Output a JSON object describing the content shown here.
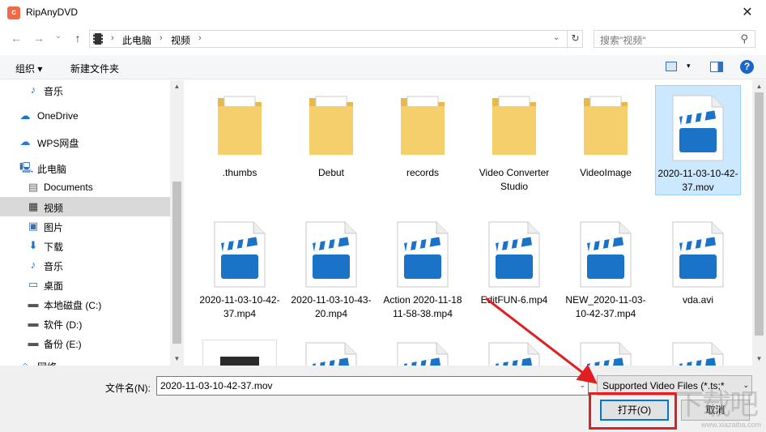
{
  "window": {
    "title": "RipAnyDVD",
    "app_icon_letter": "c",
    "close_glyph": "✕"
  },
  "nav": {
    "back": "←",
    "forward": "→",
    "dropdown": "⌄",
    "up": "↑"
  },
  "address": {
    "crumbs": [
      "此电脑",
      "视频"
    ],
    "sep": "›",
    "dropdown": "⌄",
    "refresh": "↻"
  },
  "search": {
    "placeholder": "搜索\"视频\"",
    "icon": "⚲"
  },
  "toolbar": {
    "organize": "组织 ▾",
    "new_folder": "新建文件夹",
    "view_dropdown": "▾",
    "help": "?"
  },
  "sidebar": {
    "items": [
      {
        "label": "音乐",
        "icon": "music-icon",
        "glyph": "♪",
        "color": "#1a73c7"
      },
      {
        "label": "OneDrive",
        "icon": "cloud-icon",
        "glyph": "☁",
        "color": "#1a73c7"
      },
      {
        "label": "WPS网盘",
        "icon": "wps-cloud-icon",
        "glyph": "☁",
        "color": "#2b7bd8"
      },
      {
        "label": "此电脑",
        "icon": "computer-icon",
        "glyph": "🖳",
        "color": "#2b6fb5"
      },
      {
        "label": "Documents",
        "icon": "documents-icon",
        "glyph": "▤",
        "color": "#666"
      },
      {
        "label": "视频",
        "icon": "video-icon",
        "glyph": "▦",
        "color": "#333"
      },
      {
        "label": "图片",
        "icon": "pictures-icon",
        "glyph": "▣",
        "color": "#3a6ea8"
      },
      {
        "label": "下载",
        "icon": "download-icon",
        "glyph": "⬇",
        "color": "#1a73c7"
      },
      {
        "label": "音乐",
        "icon": "music-icon",
        "glyph": "♪",
        "color": "#1a73c7"
      },
      {
        "label": "桌面",
        "icon": "desktop-icon",
        "glyph": "▭",
        "color": "#1a73c7"
      },
      {
        "label": "本地磁盘 (C:)",
        "icon": "drive-c-icon",
        "glyph": "▬",
        "color": "#555"
      },
      {
        "label": "软件 (D:)",
        "icon": "drive-d-icon",
        "glyph": "▬",
        "color": "#555"
      },
      {
        "label": "备份 (E:)",
        "icon": "drive-e-icon",
        "glyph": "▬",
        "color": "#555"
      },
      {
        "label": "网络",
        "icon": "network-icon",
        "glyph": "⌂",
        "color": "#1a73c7"
      }
    ],
    "scroll_up": "▲",
    "scroll_down": "▼"
  },
  "files": [
    {
      "name": ".thumbs",
      "type": "folder"
    },
    {
      "name": "Debut",
      "type": "folder"
    },
    {
      "name": "records",
      "type": "folder"
    },
    {
      "name": "Video Converter Studio",
      "type": "folder"
    },
    {
      "name": "VideoImage",
      "type": "folder"
    },
    {
      "name": "2020-11-03-10-42-37.mov",
      "type": "video"
    },
    {
      "name": "2020-11-03-10-42-37.mp4",
      "type": "video"
    },
    {
      "name": "2020-11-03-10-43-20.mp4",
      "type": "video"
    },
    {
      "name": "Action 2020-11-18 11-58-38.mp4",
      "type": "video"
    },
    {
      "name": "EditFUN-6.mp4",
      "type": "video"
    },
    {
      "name": "NEW_2020-11-03-10-42-37.mp4",
      "type": "video"
    },
    {
      "name": "vda.avi",
      "type": "video"
    }
  ],
  "filename": {
    "label": "文件名(N):",
    "value": "2020-11-03-10-42-37.mov",
    "dropdown": "⌄"
  },
  "filter": {
    "value": "Supported Video Files (*.ts;*",
    "dropdown": "⌄"
  },
  "buttons": {
    "open": "打开(O)",
    "cancel": "取消"
  },
  "watermark": {
    "text": "下载吧",
    "sub": "www.xiazaiba.com"
  },
  "colors": {
    "accent": "#0078d7",
    "video_icon": "#1a73c7",
    "folder": "#f5cf6b",
    "highlight": "#e02020"
  }
}
